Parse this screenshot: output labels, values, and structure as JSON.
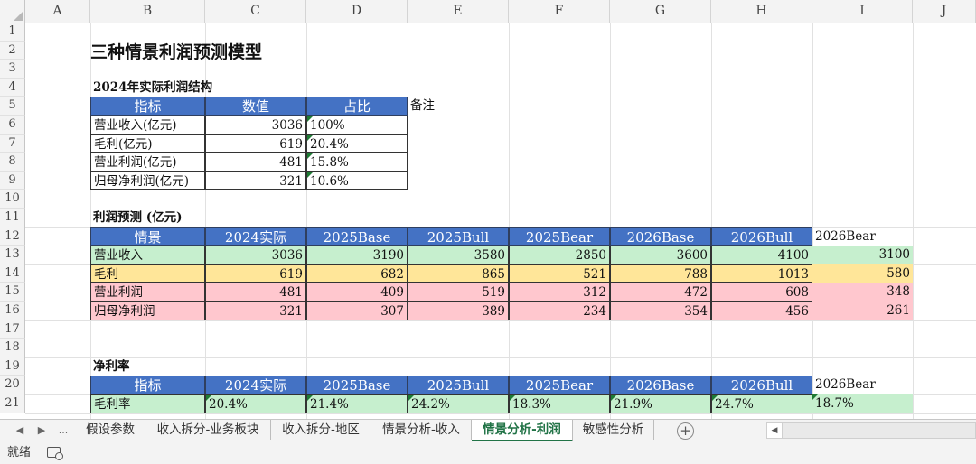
{
  "columns": [
    "A",
    "B",
    "C",
    "D",
    "E",
    "F",
    "G",
    "H",
    "I",
    "J"
  ],
  "rows": [
    "1",
    "2",
    "3",
    "4",
    "5",
    "6",
    "7",
    "8",
    "9",
    "10",
    "11",
    "12",
    "13",
    "14",
    "15",
    "16",
    "17",
    "18",
    "19",
    "20",
    "21"
  ],
  "title": "三种情景利润预测模型",
  "section1": {
    "heading": "2024年实际利润结构",
    "headers": [
      "指标",
      "数值",
      "占比"
    ],
    "note": "备注",
    "rows": [
      {
        "label": "营业收入(亿元)",
        "value": "3036",
        "pct": "100%"
      },
      {
        "label": "毛利(亿元)",
        "value": "619",
        "pct": "20.4%"
      },
      {
        "label": "营业利润(亿元)",
        "value": "481",
        "pct": "15.8%"
      },
      {
        "label": "归母净利润(亿元)",
        "value": "321",
        "pct": "10.6%"
      }
    ]
  },
  "section2": {
    "heading": "利润预测 (亿元)",
    "headers": [
      "情景",
      "2024实际",
      "2025Base",
      "2025Bull",
      "2025Bear",
      "2026Base",
      "2026Bull",
      "2026Bear"
    ],
    "rows": [
      {
        "label": "营业收入",
        "values": [
          "3036",
          "3190",
          "3580",
          "2850",
          "3600",
          "4100",
          "3100"
        ],
        "color": "#c6efce"
      },
      {
        "label": "毛利",
        "values": [
          "619",
          "682",
          "865",
          "521",
          "788",
          "1013",
          "580"
        ],
        "color": "#ffe699"
      },
      {
        "label": "营业利润",
        "values": [
          "481",
          "409",
          "519",
          "312",
          "472",
          "608",
          "348"
        ],
        "color": "#ffc7ce"
      },
      {
        "label": "归母净利润",
        "values": [
          "321",
          "307",
          "389",
          "234",
          "354",
          "456",
          "261"
        ],
        "color": "#ffc7ce"
      }
    ]
  },
  "section3": {
    "heading": "净利率",
    "headers": [
      "指标",
      "2024实际",
      "2025Base",
      "2025Bull",
      "2025Bear",
      "2026Base",
      "2026Bull",
      "2026Bear"
    ],
    "rows": [
      {
        "label": "毛利率",
        "values": [
          "20.4%",
          "21.4%",
          "24.2%",
          "18.3%",
          "21.9%",
          "24.7%",
          "18.7%"
        ]
      }
    ]
  },
  "sheet_tabs": [
    "假设参数",
    "收入拆分-业务板块",
    "收入拆分-地区",
    "情景分析-收入",
    "情景分析-利润",
    "敏感性分析"
  ],
  "active_tab": "情景分析-利润",
  "tab_nav": {
    "prev": "◀",
    "next": "▶",
    "more": "..."
  },
  "add_sheet": "+",
  "status": "就绪",
  "icons": {
    "add": "plus-circle-icon",
    "macro": "macro-record-icon"
  },
  "colors": {
    "header_blue": "#4472c4",
    "green": "#c6efce",
    "yellow": "#ffe699",
    "pink": "#ffc7ce",
    "active_tab": "#217346"
  }
}
